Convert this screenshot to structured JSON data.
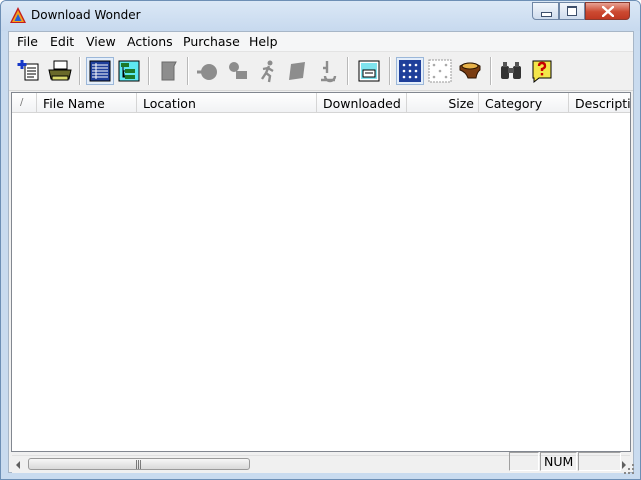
{
  "window": {
    "title": "Download Wonder"
  },
  "menu": [
    "File",
    "Edit",
    "View",
    "Actions",
    "Purchase",
    "Help"
  ],
  "toolbar": {
    "buttons": [
      "new-download-icon",
      "print-icon",
      "list-view-icon",
      "tree-view-icon",
      "scroll-icon",
      "ball-icon",
      "robot-icon",
      "runner-icon",
      "page-icon",
      "microscope-icon",
      "screen-window-icon",
      "select-all-grid-icon",
      "deselect-grid-icon",
      "helmet-icon",
      "binoculars-icon",
      "help-icon"
    ]
  },
  "columns": {
    "sort": "/",
    "file_name": "File Name",
    "location": "Location",
    "downloaded": "Downloaded",
    "size": "Size",
    "category": "Category",
    "description": "Description"
  },
  "status": {
    "num": "NUM"
  },
  "colors": {
    "titlebar": "#c9dbef",
    "close_button": "#cc4a32",
    "accent": "#1f3f9a"
  }
}
